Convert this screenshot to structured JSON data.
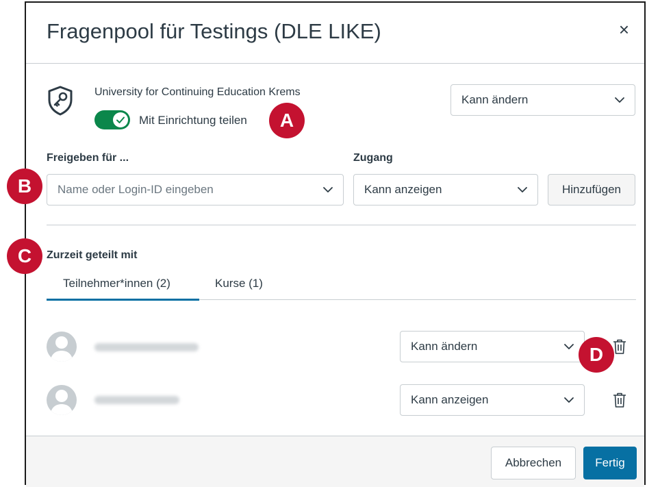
{
  "dialog": {
    "title": "Fragenpool für Testings (DLE LIKE)",
    "close_label": "×"
  },
  "institution": {
    "name": "University for Continuing Education Krems",
    "toggle_label": "Mit Einrichtung teilen",
    "toggle_on": true,
    "permission": "Kann ändern"
  },
  "share_form": {
    "share_for_label": "Freigeben für ...",
    "share_for_placeholder": "Name oder Login-ID eingeben",
    "access_label": "Zugang",
    "access_value": "Kann anzeigen",
    "add_button": "Hinzufügen"
  },
  "currently_shared": {
    "heading": "Zurzeit geteilt mit",
    "tabs": [
      {
        "label": "Teilnehmer*innen (2)",
        "active": true
      },
      {
        "label": "Kurse (1)",
        "active": false
      }
    ],
    "people": [
      {
        "permission": "Kann ändern"
      },
      {
        "permission": "Kann anzeigen"
      }
    ]
  },
  "footer": {
    "cancel": "Abbrechen",
    "done": "Fertig"
  },
  "annotations": [
    "A",
    "B",
    "C",
    "D"
  ],
  "colors": {
    "toggle_on": "#0b874b",
    "primary": "#0770a3",
    "badge": "#c41230",
    "text": "#2d3b45"
  }
}
